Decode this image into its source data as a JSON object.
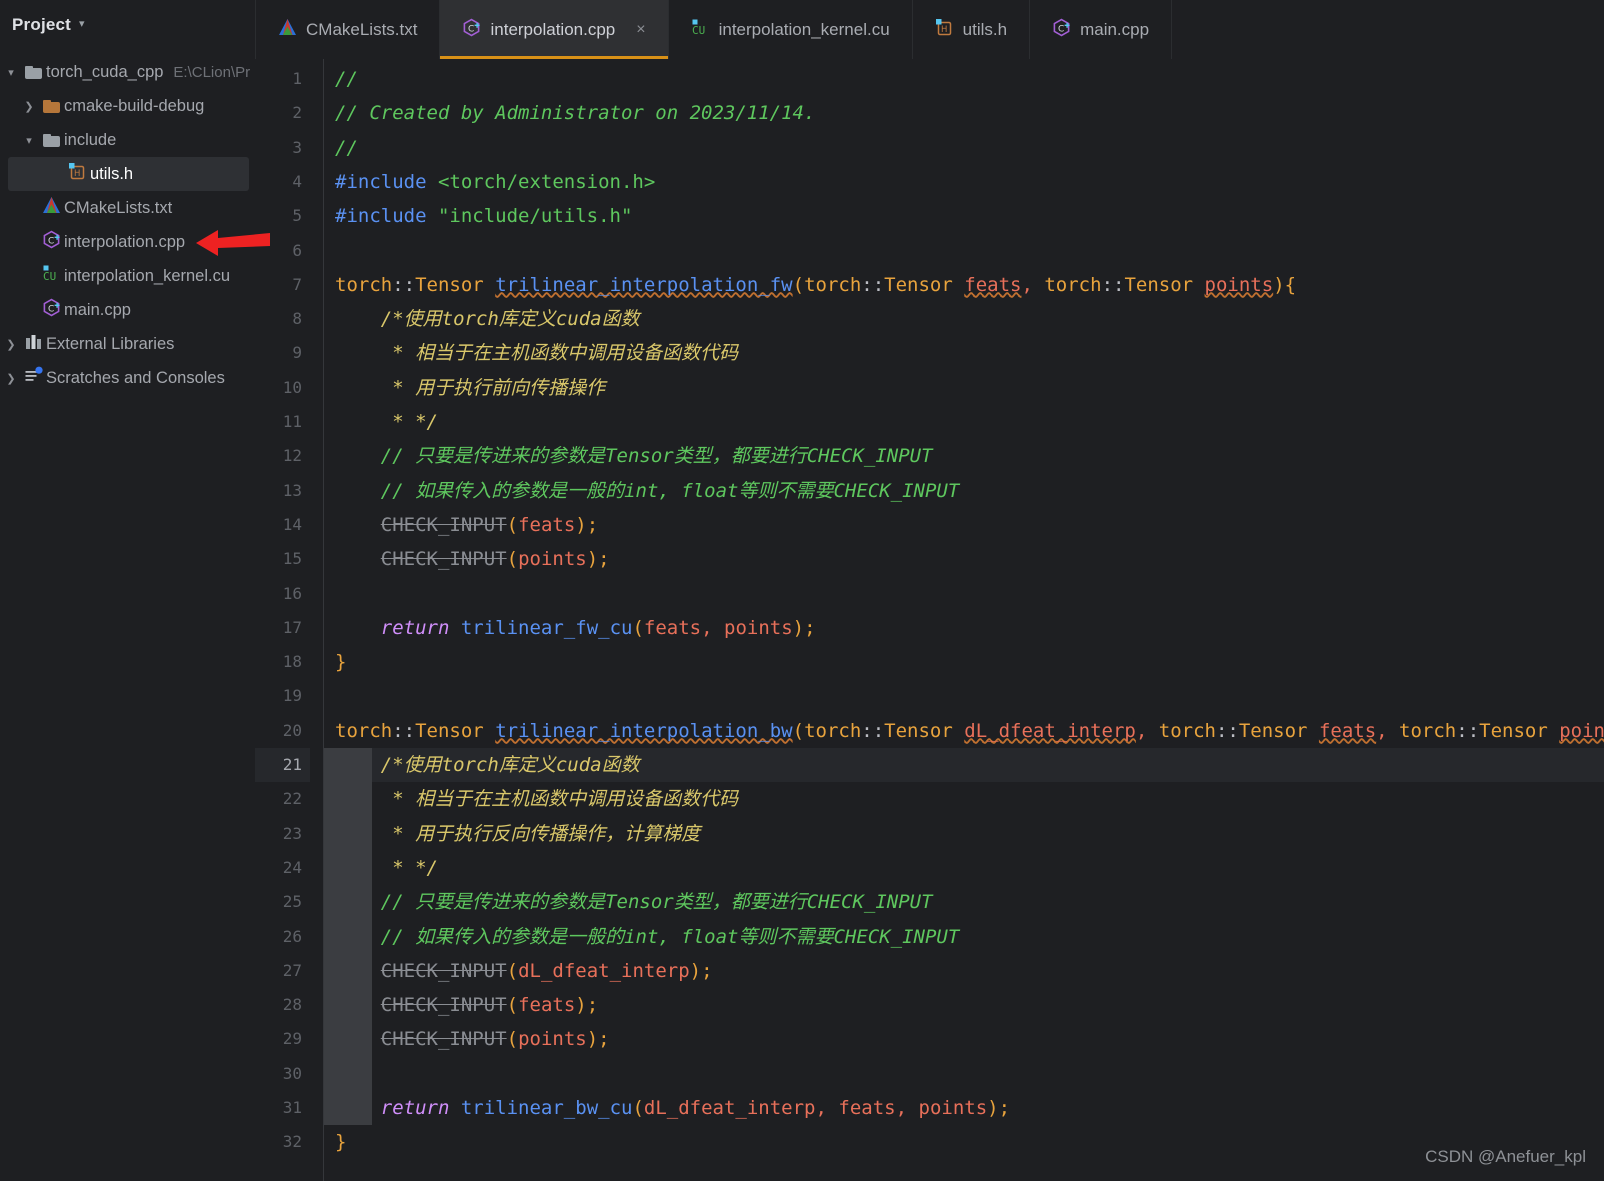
{
  "sidebar": {
    "title": "Project",
    "collapse_icon": "chevron-down-icon",
    "items": [
      {
        "label": "torch_cuda_cpp",
        "sub": "E:\\CLion\\Pr",
        "icon": "folder-icon",
        "arrow": "chevron-down-icon",
        "indent": 0,
        "selected": false
      },
      {
        "label": "cmake-build-debug",
        "sub": "",
        "icon": "folder-orange-icon",
        "arrow": "chevron-right-icon",
        "indent": 1,
        "selected": false
      },
      {
        "label": "include",
        "sub": "",
        "icon": "folder-icon",
        "arrow": "chevron-down-icon",
        "indent": 1,
        "selected": false
      },
      {
        "label": "utils.h",
        "sub": "",
        "icon": "header-file-icon",
        "arrow": "",
        "indent": 2,
        "selected": true
      },
      {
        "label": "CMakeLists.txt",
        "sub": "",
        "icon": "cmake-file-icon",
        "arrow": "",
        "indent": 1,
        "selected": false
      },
      {
        "label": "interpolation.cpp",
        "sub": "",
        "icon": "cpp-file-icon",
        "arrow": "",
        "indent": 1,
        "selected": false
      },
      {
        "label": "interpolation_kernel.cu",
        "sub": "",
        "icon": "cuda-file-icon",
        "arrow": "",
        "indent": 1,
        "selected": false
      },
      {
        "label": "main.cpp",
        "sub": "",
        "icon": "cpp-file-icon",
        "arrow": "",
        "indent": 1,
        "selected": false
      },
      {
        "label": "External Libraries",
        "sub": "",
        "icon": "library-icon",
        "arrow": "chevron-right-icon",
        "indent": 0,
        "selected": false
      },
      {
        "label": "Scratches and Consoles",
        "sub": "",
        "icon": "scratches-icon",
        "arrow": "chevron-right-icon",
        "indent": 0,
        "selected": false
      }
    ]
  },
  "tabs": [
    {
      "label": "CMakeLists.txt",
      "icon": "cmake-file-icon",
      "active": false,
      "closable": false
    },
    {
      "label": "interpolation.cpp",
      "icon": "cpp-file-icon",
      "active": true,
      "closable": true,
      "close_label": "×"
    },
    {
      "label": "interpolation_kernel.cu",
      "icon": "cuda-file-icon",
      "active": false,
      "closable": false
    },
    {
      "label": "utils.h",
      "icon": "header-file-icon",
      "active": false,
      "closable": false
    },
    {
      "label": "main.cpp",
      "icon": "cpp-file-icon",
      "active": false,
      "closable": false
    }
  ],
  "editor": {
    "active_line": 21,
    "bulb_icon": "lightbulb-intention-icon",
    "accent_color": "#d99117",
    "background_color": "#1e1f22",
    "line_numbers": [
      1,
      2,
      3,
      4,
      5,
      6,
      7,
      8,
      9,
      10,
      11,
      12,
      13,
      14,
      15,
      16,
      17,
      18,
      19,
      20,
      21,
      22,
      23,
      24,
      25,
      26,
      27,
      28,
      29,
      30,
      31,
      32
    ],
    "lines": [
      {
        "n": 1,
        "plain": "//"
      },
      {
        "n": 2,
        "plain": "// Created by Administrator on 2023/11/14."
      },
      {
        "n": 3,
        "plain": "//"
      },
      {
        "n": 4,
        "plain": "#include <torch/extension.h>"
      },
      {
        "n": 5,
        "plain": "#include \"include/utils.h\""
      },
      {
        "n": 6,
        "plain": ""
      },
      {
        "n": 7,
        "plain": "torch::Tensor trilinear_interpolation_fw(torch::Tensor feats, torch::Tensor points){"
      },
      {
        "n": 8,
        "plain": "    /*使用torch库定义cuda函数"
      },
      {
        "n": 9,
        "plain": "     * 相当于在主机函数中调用设备函数代码"
      },
      {
        "n": 10,
        "plain": "     * 用于执行前向传播操作"
      },
      {
        "n": 11,
        "plain": "     * */"
      },
      {
        "n": 12,
        "plain": "    // 只要是传进来的参数是Tensor类型，都要进行CHECK_INPUT"
      },
      {
        "n": 13,
        "plain": "    // 如果传入的参数是一般的int, float等则不需要CHECK_INPUT"
      },
      {
        "n": 14,
        "plain": "    CHECK_INPUT(feats);"
      },
      {
        "n": 15,
        "plain": "    CHECK_INPUT(points);"
      },
      {
        "n": 16,
        "plain": ""
      },
      {
        "n": 17,
        "plain": "    return trilinear_fw_cu(feats, points);"
      },
      {
        "n": 18,
        "plain": "}"
      },
      {
        "n": 19,
        "plain": ""
      },
      {
        "n": 20,
        "plain": "torch::Tensor trilinear_interpolation_bw(torch::Tensor dL_dfeat_interp, torch::Tensor feats, torch::Tensor points){"
      },
      {
        "n": 21,
        "plain": "    /*使用torch库定义cuda函数"
      },
      {
        "n": 22,
        "plain": "     * 相当于在主机函数中调用设备函数代码"
      },
      {
        "n": 23,
        "plain": "     * 用于执行反向传播操作，计算梯度"
      },
      {
        "n": 24,
        "plain": "     * */"
      },
      {
        "n": 25,
        "plain": "    // 只要是传进来的参数是Tensor类型，都要进行CHECK_INPUT"
      },
      {
        "n": 26,
        "plain": "    // 如果传入的参数是一般的int, float等则不需要CHECK_INPUT"
      },
      {
        "n": 27,
        "plain": "    CHECK_INPUT(dL_dfeat_interp);"
      },
      {
        "n": 28,
        "plain": "    CHECK_INPUT(feats);"
      },
      {
        "n": 29,
        "plain": "    CHECK_INPUT(points);"
      },
      {
        "n": 30,
        "plain": ""
      },
      {
        "n": 31,
        "plain": "    return trilinear_bw_cu(dL_dfeat_interp, feats, points);"
      },
      {
        "n": 32,
        "plain": "}"
      }
    ]
  },
  "annotation": {
    "arrow_color": "#ee2222",
    "arrow_icon": "left-arrow-annotation"
  },
  "watermark": {
    "text": "CSDN @Anefuer_kpl"
  }
}
